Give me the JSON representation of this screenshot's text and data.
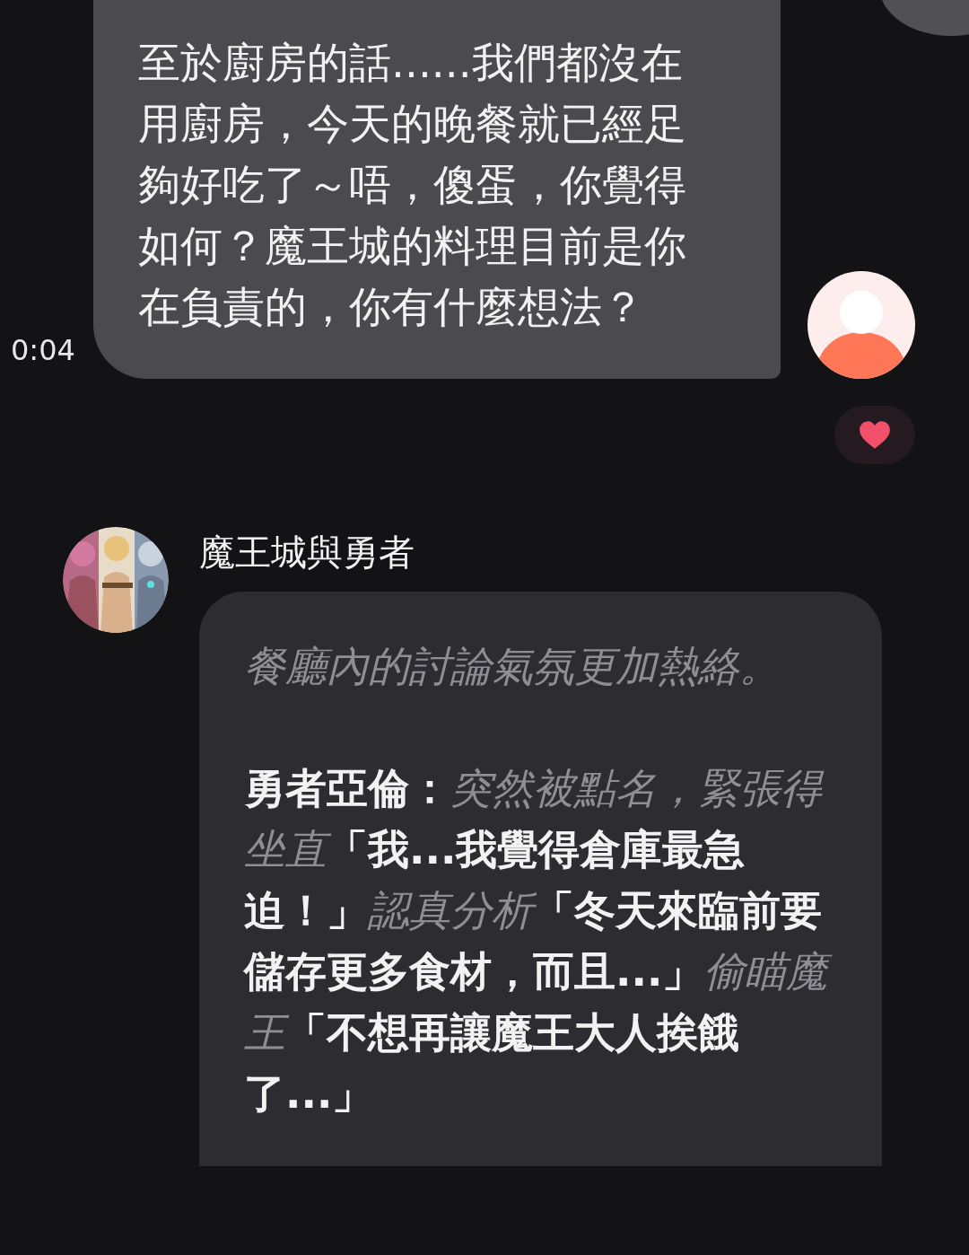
{
  "messages": [
    {
      "kind": "user",
      "time": "0:04",
      "text": "至於廚房的話......我們都沒在用廚房，今天的晚餐就已經足夠好吃了～唔，傻蛋，你覺得如何？魔王城的料理目前是你在負責的，你有什麼想法？",
      "liked": true
    },
    {
      "kind": "bot",
      "sender": "魔王城與勇者",
      "paragraphs": [
        {
          "kind": "narration",
          "text": "餐廳內的討論氣氛更加熱絡。"
        },
        {
          "kind": "dialogue",
          "text": "勇者亞倫：*突然被點名，緊張得坐直*「我...我覺得倉庫最急迫！」*認真分析*「冬天來臨前要儲存更多食材，而且...」*偷瞄魔王*「不想再讓魔王大人挨餓了...」"
        }
      ]
    }
  ]
}
